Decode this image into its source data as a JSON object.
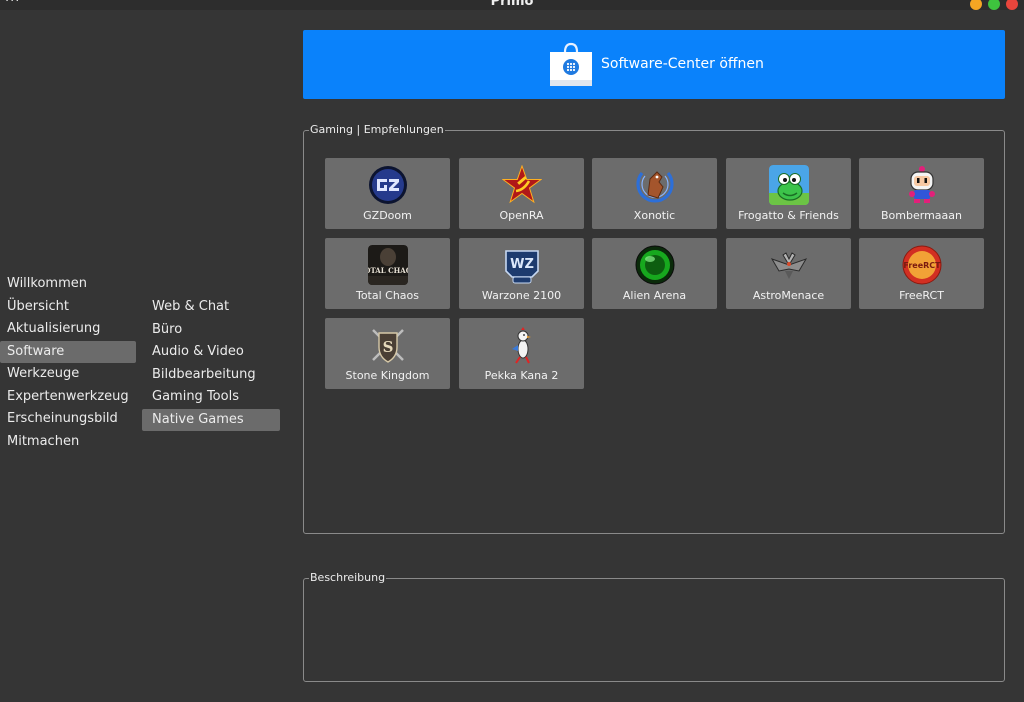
{
  "window": {
    "title": "Primo",
    "menu_label": "···"
  },
  "sidebar": {
    "items": [
      {
        "label": "Willkommen"
      },
      {
        "label": "Übersicht"
      },
      {
        "label": "Aktualisierung"
      },
      {
        "label": "Software",
        "active": true
      },
      {
        "label": "Werkzeuge"
      },
      {
        "label": "Expertenwerkzeug"
      },
      {
        "label": "Erscheinungsbild"
      },
      {
        "label": "Mitmachen"
      }
    ]
  },
  "subnav": {
    "items": [
      {
        "label": "Web & Chat"
      },
      {
        "label": "Büro"
      },
      {
        "label": "Audio & Video"
      },
      {
        "label": "Bildbearbeitung"
      },
      {
        "label": "Gaming Tools"
      },
      {
        "label": "Native Games",
        "active": true
      }
    ]
  },
  "software_center": {
    "label": "Software-Center öffnen",
    "icon": "shopping-bag-icon",
    "accent": "#0a82fb"
  },
  "gaming": {
    "title": "Gaming | Empfehlungen",
    "games": [
      {
        "name": "GZDoom",
        "icon": "gzdoom-icon"
      },
      {
        "name": "OpenRA",
        "icon": "openra-icon"
      },
      {
        "name": "Xonotic",
        "icon": "xonotic-icon"
      },
      {
        "name": "Frogatto & Friends",
        "icon": "frogatto-icon"
      },
      {
        "name": "Bombermaaan",
        "icon": "bombermaaan-icon"
      },
      {
        "name": "Total Chaos",
        "icon": "total-chaos-icon",
        "icon_text": "TOTAL CHAOS"
      },
      {
        "name": "Warzone 2100",
        "icon": "warzone-icon",
        "icon_text": "WZ"
      },
      {
        "name": "Alien Arena",
        "icon": "alien-arena-icon"
      },
      {
        "name": "AstroMenace",
        "icon": "astromenace-icon"
      },
      {
        "name": "FreeRCT",
        "icon": "freerct-icon",
        "icon_text": "FreeRCT"
      },
      {
        "name": "Stone Kingdom",
        "icon": "stone-kingdom-icon",
        "icon_text": "S"
      },
      {
        "name": "Pekka Kana 2",
        "icon": "pekka-kana-icon"
      }
    ]
  },
  "description": {
    "title": "Beschreibung",
    "text": ""
  }
}
